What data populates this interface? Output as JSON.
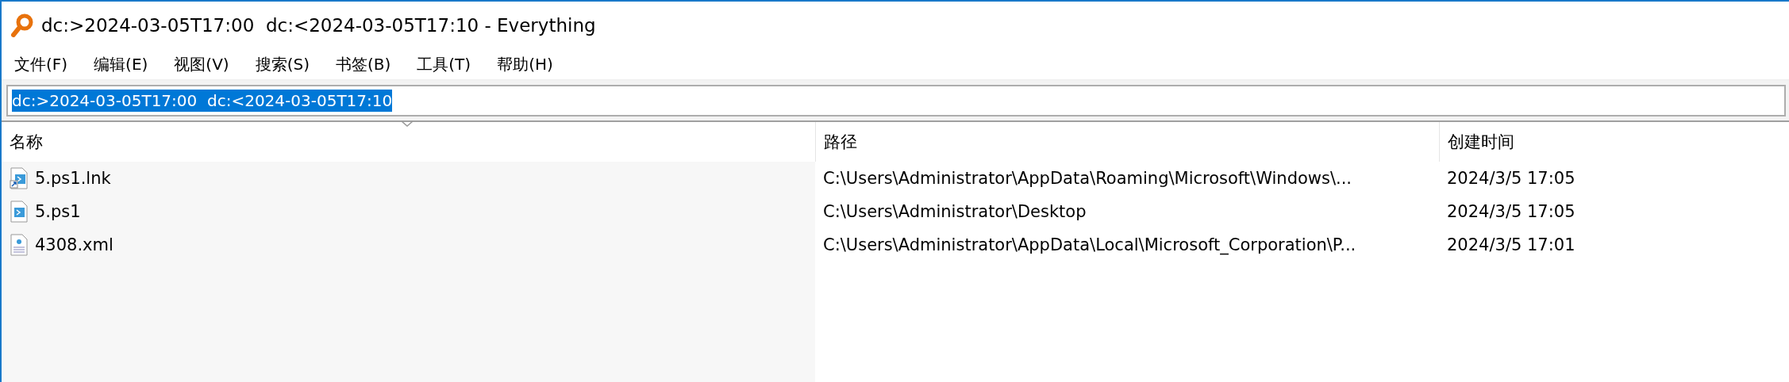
{
  "window": {
    "title": "dc:>2024-03-05T17:00  dc:<2024-03-05T17:10 - Everything"
  },
  "menu": [
    "文件(F)",
    "编辑(E)",
    "视图(V)",
    "搜索(S)",
    "书签(B)",
    "工具(T)",
    "帮助(H)"
  ],
  "search": {
    "value": "dc:>2024-03-05T17:00  dc:<2024-03-05T17:10",
    "selected": true
  },
  "table": {
    "columns": [
      {
        "label": "名称",
        "sorted": true
      },
      {
        "label": "路径",
        "sorted": false
      },
      {
        "label": "创建时间",
        "sorted": false
      }
    ],
    "rows": [
      {
        "kind": "shortcut",
        "name": "5.ps1.lnk",
        "path": "C:\\Users\\Administrator\\AppData\\Roaming\\Microsoft\\Windows\\...",
        "created": "2024/3/5 17:05"
      },
      {
        "kind": "script",
        "name": "5.ps1",
        "path": "C:\\Users\\Administrator\\Desktop",
        "created": "2024/3/5 17:05"
      },
      {
        "kind": "xml",
        "name": "4308.xml",
        "path": "C:\\Users\\Administrator\\AppData\\Local\\Microsoft_Corporation\\P...",
        "created": "2024/3/5 17:01"
      }
    ]
  }
}
